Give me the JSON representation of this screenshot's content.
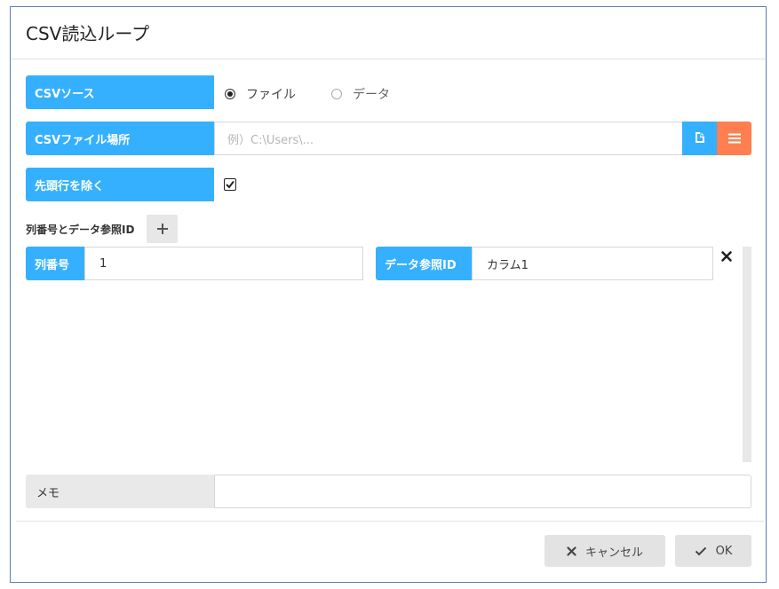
{
  "dialog": {
    "title": "CSV読込ループ"
  },
  "csv_source": {
    "label": "CSVソース",
    "options": [
      {
        "label": "ファイル",
        "selected": true
      },
      {
        "label": "データ",
        "selected": false
      }
    ]
  },
  "csv_file_location": {
    "label": "CSVファイル場所",
    "value": "",
    "placeholder": "例）C:\\Users\\...",
    "file_button_color": "#35b0ff",
    "list_button_color": "#ff7f50"
  },
  "skip_header": {
    "label": "先頭行を除く",
    "checked": true
  },
  "columns_section": {
    "label": "列番号とデータ参照ID",
    "rows": [
      {
        "column_label": "列番号",
        "column_value": "1",
        "ref_label": "データ参照ID",
        "ref_value": "カラム1"
      }
    ]
  },
  "memo": {
    "label": "メモ",
    "value": ""
  },
  "footer": {
    "cancel_label": "キャンセル",
    "ok_label": "OK"
  },
  "colors": {
    "accent": "#35b0ff",
    "orange": "#ff7f50",
    "border": "#5b7fb3"
  }
}
